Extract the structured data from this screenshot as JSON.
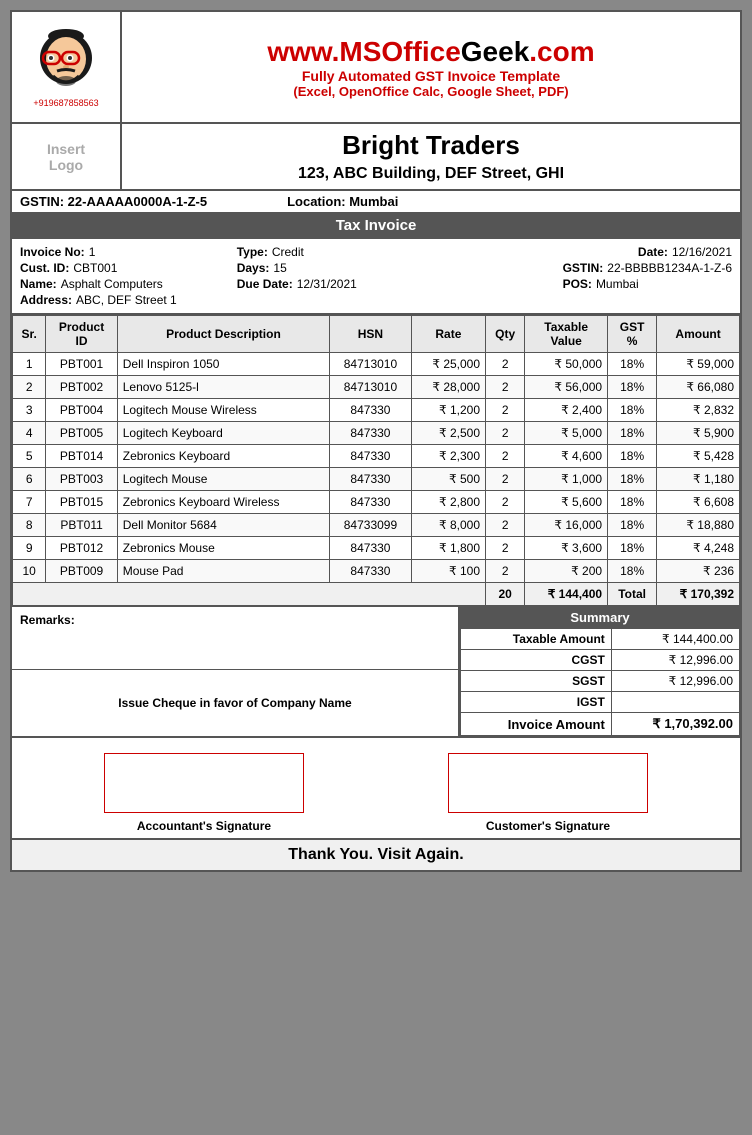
{
  "header": {
    "site_url_red": "www.MSOffice",
    "site_url_black": "Geek",
    "site_url_tld": ".com",
    "subtitle1": "Fully Automated GST Invoice Template",
    "subtitle2": "(Excel, OpenOffice Calc, Google Sheet, PDF)",
    "phone": "+919687858563"
  },
  "company": {
    "insert_logo": "Insert\nLogo",
    "name": "Bright Traders",
    "address": "123, ABC Building, DEF Street, GHI"
  },
  "gstin_bar": {
    "gstin": "GSTIN:  22-AAAAA0000A-1-Z-5",
    "location": "Location:  Mumbai"
  },
  "invoice_type": "Tax Invoice",
  "invoice_details": {
    "invoice_no_label": "Invoice No:",
    "invoice_no": "1",
    "cust_id_label": "Cust. ID:",
    "cust_id": "CBT001",
    "name_label": "Name:",
    "name": "Asphalt Computers",
    "address_label": "Address:",
    "address": "ABC, DEF Street 1",
    "type_label": "Type:",
    "type": "Credit",
    "days_label": "Days:",
    "days": "15",
    "due_date_label": "Due Date:",
    "due_date": "12/31/2021",
    "date_label": "Date:",
    "date": "12/16/2021",
    "gstin_label": "GSTIN:",
    "gstin": "22-BBBBB1234A-1-Z-6",
    "pos_label": "POS:",
    "pos": "Mumbai"
  },
  "table": {
    "headers": [
      "Sr.",
      "Product\nID",
      "Product Description",
      "HSN",
      "Rate",
      "Qty",
      "Taxable\nValue",
      "GST\n%",
      "Amount"
    ],
    "rows": [
      {
        "sr": "1",
        "pid": "PBT001",
        "desc": "Dell Inspiron 1050",
        "hsn": "84713010",
        "rate": "₹ 25,000",
        "qty": "2",
        "taxable": "₹ 50,000",
        "gst": "18%",
        "amount": "₹ 59,000"
      },
      {
        "sr": "2",
        "pid": "PBT002",
        "desc": "Lenovo 5125-l",
        "hsn": "84713010",
        "rate": "₹ 28,000",
        "qty": "2",
        "taxable": "₹ 56,000",
        "gst": "18%",
        "amount": "₹ 66,080"
      },
      {
        "sr": "3",
        "pid": "PBT004",
        "desc": "Logitech Mouse Wireless",
        "hsn": "847330",
        "rate": "₹ 1,200",
        "qty": "2",
        "taxable": "₹ 2,400",
        "gst": "18%",
        "amount": "₹ 2,832"
      },
      {
        "sr": "4",
        "pid": "PBT005",
        "desc": "Logitech Keyboard",
        "hsn": "847330",
        "rate": "₹ 2,500",
        "qty": "2",
        "taxable": "₹ 5,000",
        "gst": "18%",
        "amount": "₹ 5,900"
      },
      {
        "sr": "5",
        "pid": "PBT014",
        "desc": "Zebronics Keyboard",
        "hsn": "847330",
        "rate": "₹ 2,300",
        "qty": "2",
        "taxable": "₹ 4,600",
        "gst": "18%",
        "amount": "₹ 5,428"
      },
      {
        "sr": "6",
        "pid": "PBT003",
        "desc": "Logitech Mouse",
        "hsn": "847330",
        "rate": "₹ 500",
        "qty": "2",
        "taxable": "₹ 1,000",
        "gst": "18%",
        "amount": "₹ 1,180"
      },
      {
        "sr": "7",
        "pid": "PBT015",
        "desc": "Zebronics Keyboard Wireless",
        "hsn": "847330",
        "rate": "₹ 2,800",
        "qty": "2",
        "taxable": "₹ 5,600",
        "gst": "18%",
        "amount": "₹ 6,608"
      },
      {
        "sr": "8",
        "pid": "PBT011",
        "desc": "Dell Monitor 5684",
        "hsn": "84733099",
        "rate": "₹ 8,000",
        "qty": "2",
        "taxable": "₹ 16,000",
        "gst": "18%",
        "amount": "₹ 18,880"
      },
      {
        "sr": "9",
        "pid": "PBT012",
        "desc": "Zebronics Mouse",
        "hsn": "847330",
        "rate": "₹ 1,800",
        "qty": "2",
        "taxable": "₹ 3,600",
        "gst": "18%",
        "amount": "₹ 4,248"
      },
      {
        "sr": "10",
        "pid": "PBT009",
        "desc": "Mouse Pad",
        "hsn": "847330",
        "rate": "₹ 100",
        "qty": "2",
        "taxable": "₹ 200",
        "gst": "18%",
        "amount": "₹ 236"
      }
    ],
    "totals": {
      "qty": "20",
      "taxable": "₹ 144,400",
      "gst_label": "Total",
      "amount": "₹ 170,392"
    }
  },
  "remarks_label": "Remarks:",
  "cheque_text": "Issue Cheque in favor of Company Name",
  "summary": {
    "header": "Summary",
    "taxable_label": "Taxable Amount",
    "taxable_val": "₹ 144,400.00",
    "cgst_label": "CGST",
    "cgst_val": "₹ 12,996.00",
    "sgst_label": "SGST",
    "sgst_val": "₹ 12,996.00",
    "igst_label": "IGST",
    "igst_val": "",
    "invoice_amount_label": "Invoice Amount",
    "invoice_amount_val": "₹ 1,70,392.00"
  },
  "signatures": {
    "accountant": "Accountant's Signature",
    "customer": "Customer's Signature"
  },
  "thankyou": "Thank You. Visit Again."
}
